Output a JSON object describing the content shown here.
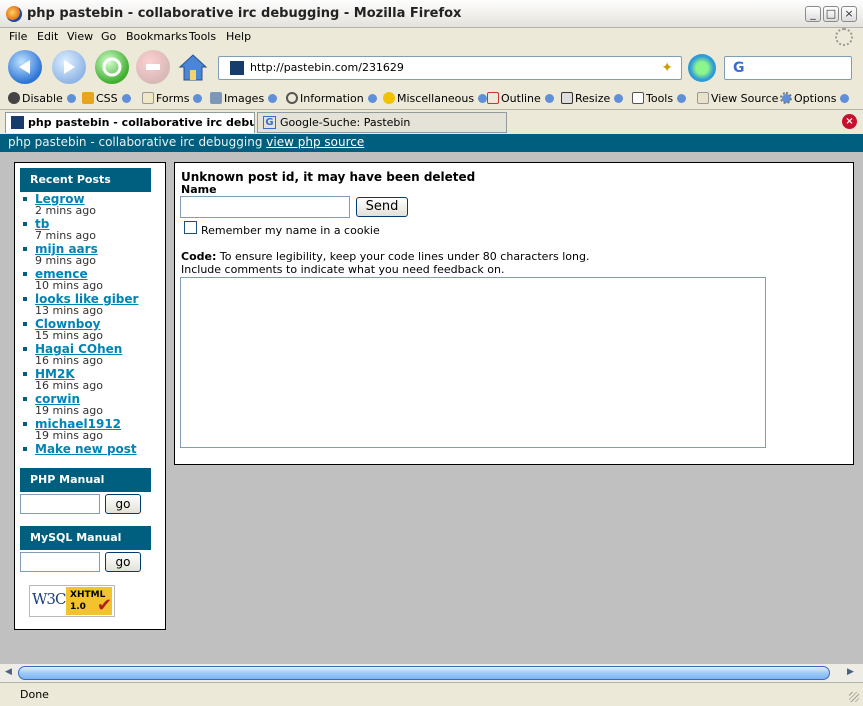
{
  "window": {
    "title": "php pastebin - collaborative irc debugging - Mozilla Firefox",
    "controls": [
      "_",
      "□",
      "×"
    ]
  },
  "menu": [
    "File",
    "Edit",
    "View",
    "Go",
    "Bookmarks",
    "Tools",
    "Help"
  ],
  "nav": {
    "url": "http://pastebin.com/231629",
    "search_value": ""
  },
  "devtoolbar": [
    "Disable",
    "CSS",
    "Forms",
    "Images",
    "Information",
    "Miscellaneous",
    "Outline",
    "Resize",
    "Tools",
    "View Source",
    "Options"
  ],
  "tabs": [
    {
      "label": "php pastebin - collaborative irc debug...",
      "active": true
    },
    {
      "label": "Google-Suche: Pastebin",
      "active": false
    }
  ],
  "site_header": {
    "text": "php pastebin - collaborative irc debugging",
    "link": "view php source"
  },
  "sidebar": {
    "recent_title": "Recent Posts",
    "posts": [
      {
        "name": "Legrow",
        "time": "2 mins ago"
      },
      {
        "name": "tb",
        "time": "7 mins ago"
      },
      {
        "name": "mijn aars",
        "time": "9 mins ago"
      },
      {
        "name": "emence",
        "time": "10 mins ago"
      },
      {
        "name": "looks like giber",
        "time": "13 mins ago"
      },
      {
        "name": "Clownboy",
        "time": "15 mins ago"
      },
      {
        "name": "Hagai COhen",
        "time": "16 mins ago"
      },
      {
        "name": "HM2K",
        "time": "16 mins ago"
      },
      {
        "name": "corwin",
        "time": "19 mins ago"
      },
      {
        "name": "michael1912",
        "time": "19 mins ago"
      }
    ],
    "new_post": "Make new post",
    "php_title": "PHP Manual",
    "mysql_title": "MySQL Manual",
    "go_label": "go",
    "badge_w3c": "W3C",
    "badge_xhtml": "XHTML",
    "badge_version": "1.0"
  },
  "main": {
    "error": "Unknown post id, it may have been deleted",
    "name_label": "Name",
    "name_value": "",
    "send_label": "Send",
    "remember_label": "Remember my name in a cookie",
    "code_label": "Code:",
    "code_hint_1": "To ensure legibility, keep your code lines under 80 characters long.",
    "code_hint_2": "Include comments to indicate what you need feedback on."
  },
  "status": {
    "text": "Done"
  }
}
